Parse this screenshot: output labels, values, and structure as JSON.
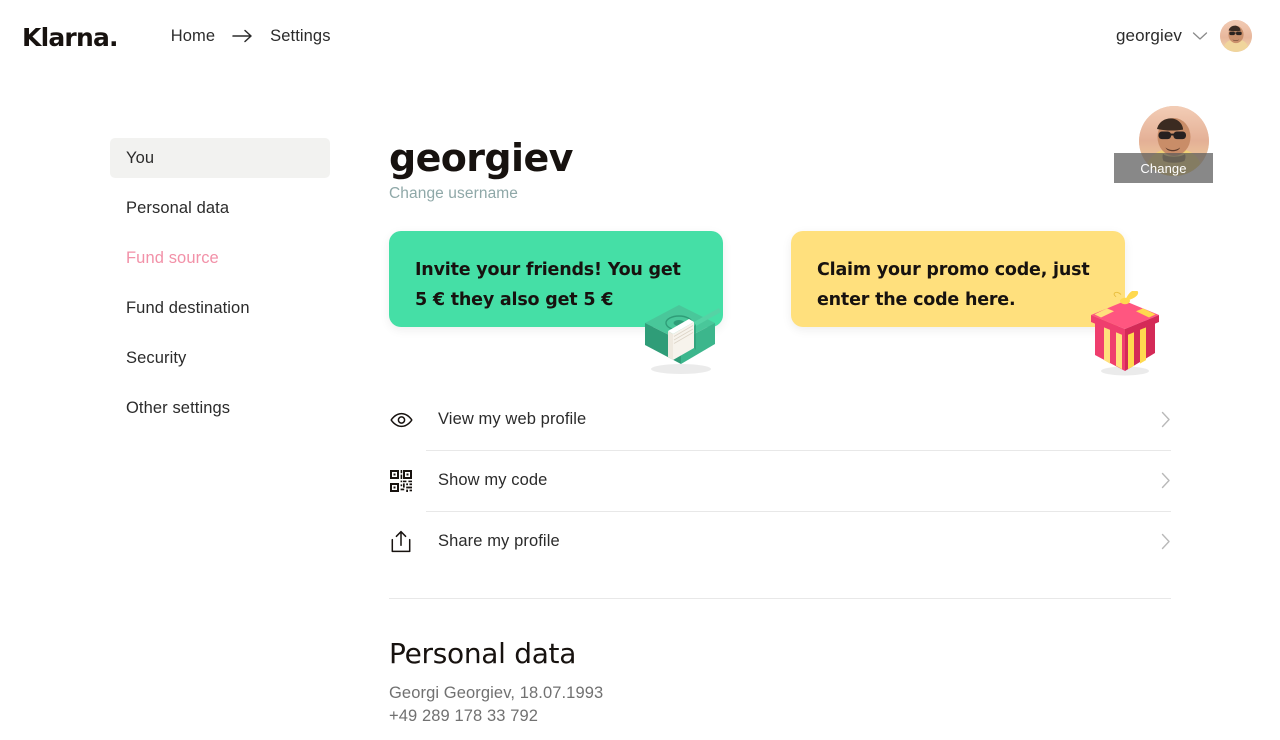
{
  "header": {
    "logo_text": "Klarna.",
    "logo_icon": "klarna-wordmark",
    "breadcrumb": {
      "home": "Home",
      "arrow_icon": "arrow-right-icon",
      "current": "Settings"
    },
    "account_name": "georgiev",
    "account_chevron_icon": "chevron-down-icon",
    "avatar_icon": "user-avatar-photo"
  },
  "sidebar": {
    "items": [
      {
        "label": "You",
        "state": "active"
      },
      {
        "label": "Personal data",
        "state": "default"
      },
      {
        "label": "Fund source",
        "state": "accent"
      },
      {
        "label": "Fund destination",
        "state": "default"
      },
      {
        "label": "Security",
        "state": "default"
      },
      {
        "label": "Other settings",
        "state": "default"
      }
    ]
  },
  "profile": {
    "username": "georgiev",
    "change_username_label": "Change username",
    "avatar_change_label": "Change",
    "avatar_icon": "user-avatar-photo"
  },
  "promos": [
    {
      "text": "Invite your friends! You get 5 € they also get 5 €",
      "art_icon": "money-stack-illustration",
      "bg": "#45DFA6"
    },
    {
      "text": "Claim your promo code, just enter the code here.",
      "art_icon": "gift-box-illustration",
      "bg": "#FFE07D"
    }
  ],
  "actions": [
    {
      "label": "View my web profile",
      "icon": "eye-icon",
      "chevron_icon": "chevron-right-icon"
    },
    {
      "label": "Show my code",
      "icon": "qr-code-icon",
      "chevron_icon": "chevron-right-icon"
    },
    {
      "label": "Share my profile",
      "icon": "share-icon",
      "chevron_icon": "chevron-right-icon"
    }
  ],
  "personal_data": {
    "title": "Personal data",
    "line1": "Georgi Georgiev, 18.07.1993",
    "line2": "+49 289 178 33 792"
  },
  "colors": {
    "accent_pink": "#F291A8",
    "promo_green": "#45DFA6",
    "promo_yellow": "#FFE07D",
    "link_teal": "#8FA8A8",
    "text_dark": "#17120F",
    "text_muted": "#717171",
    "active_bg": "#F2F2F0"
  }
}
